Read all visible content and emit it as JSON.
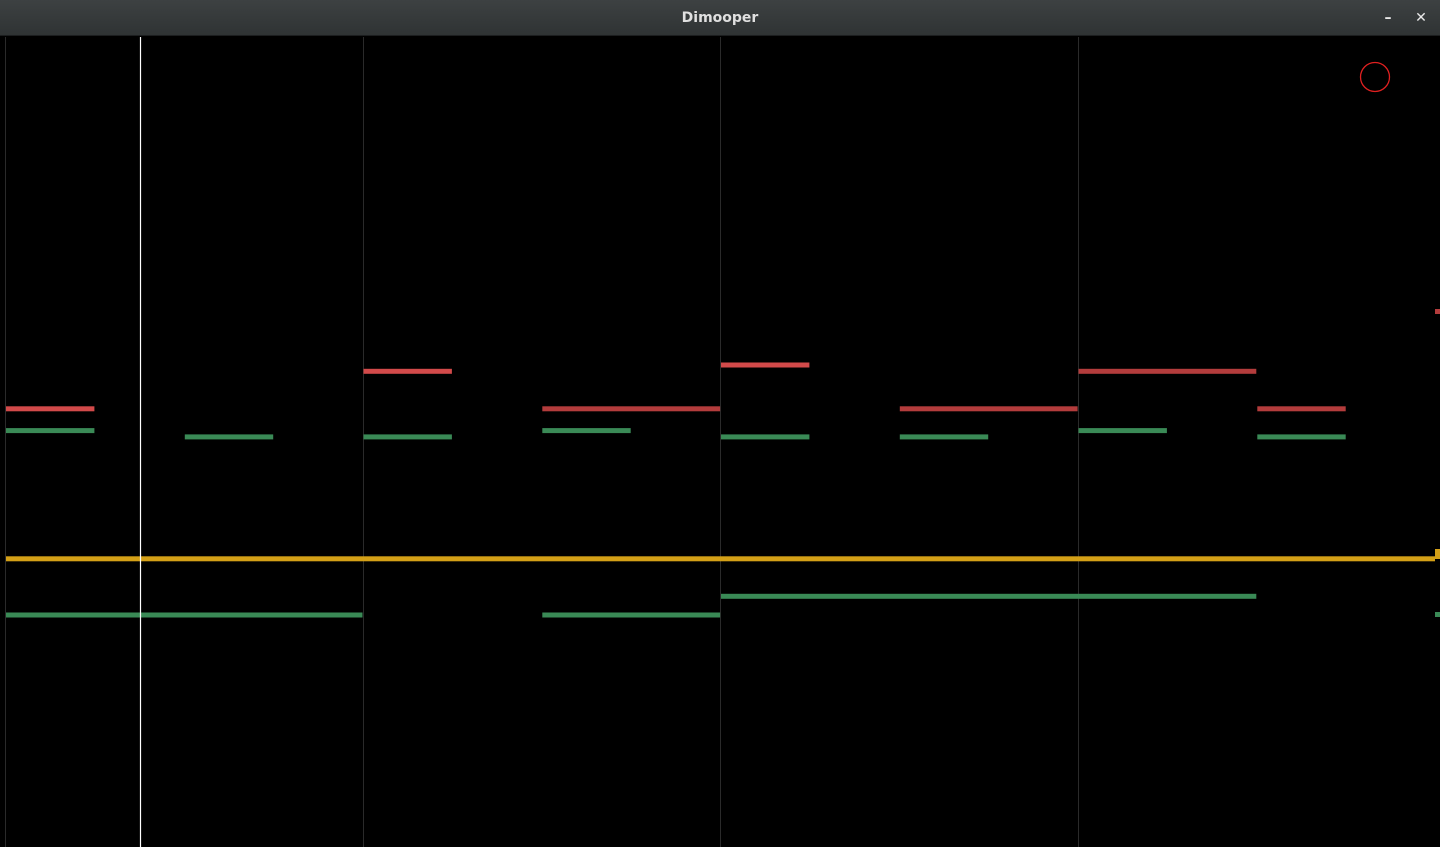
{
  "window": {
    "title": "Dimooper",
    "minimize_icon": "minimize-icon",
    "close_icon": "close-icon"
  },
  "indicator": {
    "icon": "record-indicator-circle-icon",
    "color": "#e02020"
  },
  "colors": {
    "background": "#000000",
    "bar_line": "#2a2a2a",
    "playhead": "#ffffff",
    "note_red": "#d24a4a",
    "note_red_dim": "#b33c3c",
    "note_green": "#3a8a56",
    "note_yellow": "#d4a017"
  },
  "playhead_beat": 1.5,
  "bars": 4,
  "beats_per_bar": 4,
  "notes": [
    {
      "start": 0,
      "dur": 1,
      "pitch": 81,
      "color": "note_red"
    },
    {
      "start": 0,
      "dur": 1,
      "pitch": 77.5,
      "color": "note_green"
    },
    {
      "start": 2,
      "dur": 1,
      "pitch": 76.5,
      "color": "note_green"
    },
    {
      "start": 4,
      "dur": 1,
      "pitch": 87,
      "color": "note_red"
    },
    {
      "start": 4,
      "dur": 1,
      "pitch": 76.5,
      "color": "note_green"
    },
    {
      "start": 6,
      "dur": 2,
      "pitch": 81,
      "color": "note_red_dim"
    },
    {
      "start": 6,
      "dur": 1,
      "pitch": 77.5,
      "color": "note_green"
    },
    {
      "start": 8,
      "dur": 1,
      "pitch": 88,
      "color": "note_red"
    },
    {
      "start": 8,
      "dur": 1,
      "pitch": 76.5,
      "color": "note_green"
    },
    {
      "start": 10,
      "dur": 2,
      "pitch": 81,
      "color": "note_red_dim"
    },
    {
      "start": 10,
      "dur": 1,
      "pitch": 76.5,
      "color": "note_green"
    },
    {
      "start": 12,
      "dur": 2,
      "pitch": 87,
      "color": "note_red_dim"
    },
    {
      "start": 12,
      "dur": 1,
      "pitch": 77.5,
      "color": "note_green"
    },
    {
      "start": 14,
      "dur": 1,
      "pitch": 81,
      "color": "note_red_dim"
    },
    {
      "start": 14,
      "dur": 1,
      "pitch": 76.5,
      "color": "note_green"
    },
    {
      "start": 0,
      "dur": 16,
      "pitch": 57,
      "color": "note_yellow"
    },
    {
      "start": 0,
      "dur": 4,
      "pitch": 48,
      "color": "note_green"
    },
    {
      "start": 6,
      "dur": 2,
      "pitch": 48,
      "color": "note_green"
    },
    {
      "start": 8,
      "dur": 6,
      "pitch": 51,
      "color": "note_green"
    }
  ]
}
